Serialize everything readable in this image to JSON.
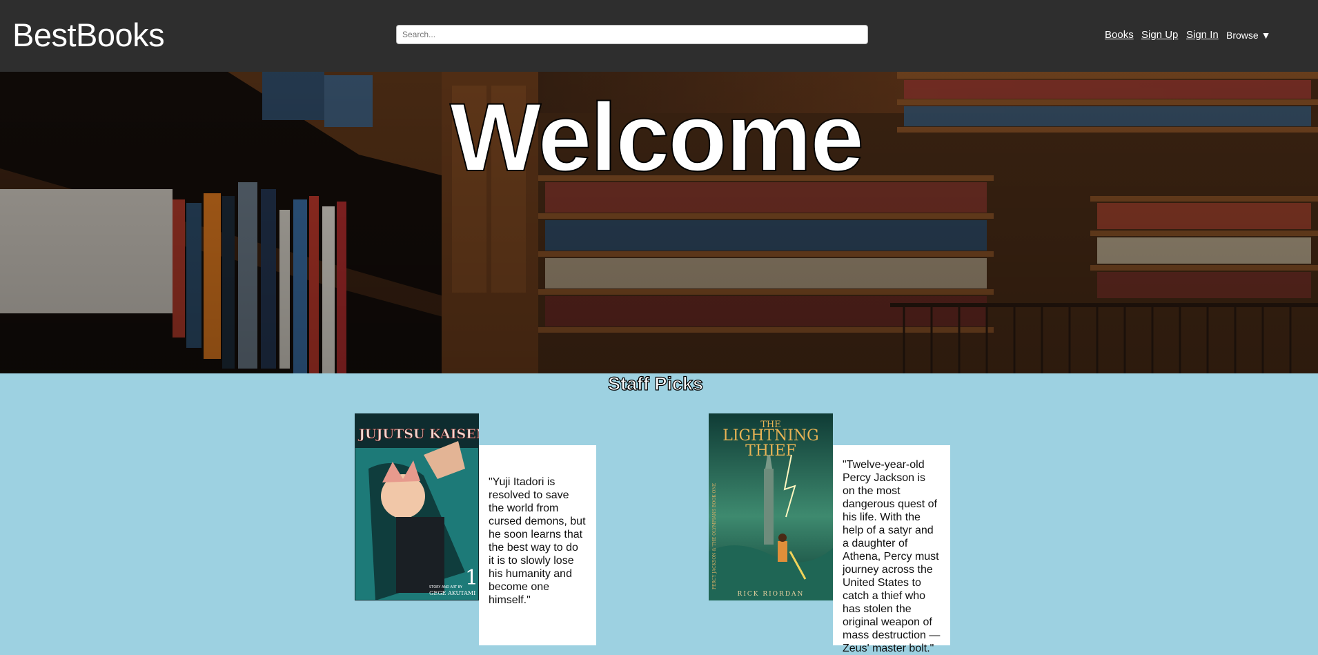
{
  "header": {
    "logo": "BestBooks",
    "search_placeholder": "Search...",
    "nav": {
      "books": "Books",
      "sign_up": "Sign Up",
      "sign_in": "Sign In",
      "browse": "Browse ▼"
    }
  },
  "hero": {
    "title": "Welcome"
  },
  "staff_picks": {
    "title": "Staff Picks",
    "books": [
      {
        "cover_title": "JUJUTSU KAISEN",
        "cover_volume": "1",
        "cover_author_prefix": "STORY AND ART BY",
        "cover_author": "GEGE AKUTAMI",
        "blurb": "\"Yuji Itadori is resolved to save the world from cursed demons, but he soon learns that the best way to do it is to slowly lose his humanity and become one himself.\""
      },
      {
        "cover_title_line1": "THE",
        "cover_title_line2": "LIGHTNING",
        "cover_title_line3": "THIEF",
        "cover_spine": "PERCY JACKSON & THE OLYMPIANS BOOK ONE",
        "cover_author": "RICK RIORDAN",
        "blurb": "\"Twelve-year-old Percy Jackson is on the most dangerous quest of his life. With the help of a satyr and a daughter of Athena, Percy must journey across the United States to catch a thief who has stolen the original weapon of mass destruction — Zeus' master bolt.\""
      }
    ]
  },
  "colors": {
    "header_bg": "#2e2e2e",
    "picks_bg": "#9dd1e1",
    "text_light": "#ffffff"
  }
}
